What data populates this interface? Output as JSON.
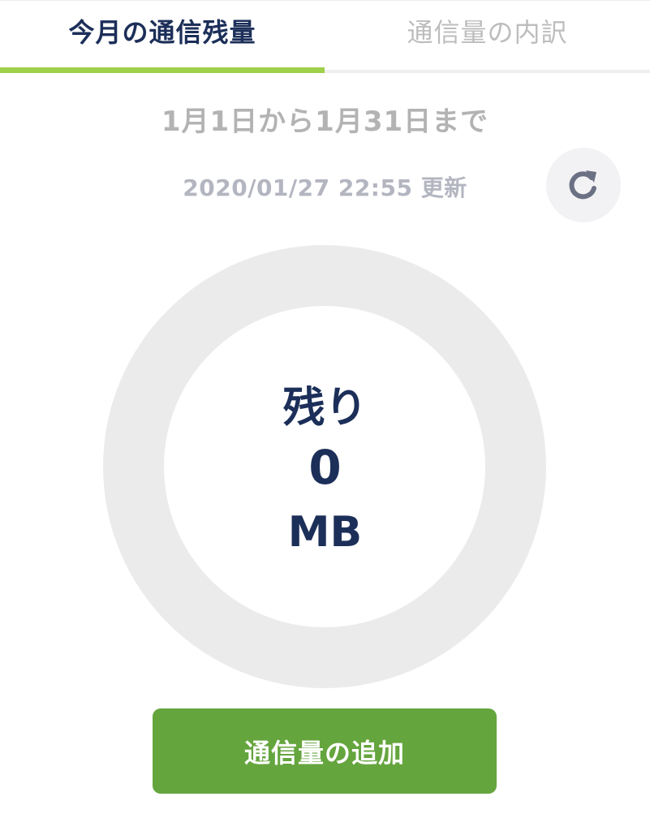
{
  "tabs": [
    {
      "label": "今月の通信残量",
      "active": true
    },
    {
      "label": "通信量の内訳",
      "active": false
    }
  ],
  "period": "1月1日から1月31日まで",
  "updated": "2020/01/27 22:55 更新",
  "refresh": {
    "icon": "refresh-icon"
  },
  "gauge": {
    "label": "残り",
    "value": "0",
    "unit": "MB",
    "fraction_remaining": 0
  },
  "add_button": {
    "label": "通信量の追加"
  },
  "colors": {
    "accent": "#9ed04a",
    "primary_text": "#1c2f59",
    "button": "#65a53e",
    "muted": "#b3b3b3",
    "ring": "#ebebeb"
  }
}
